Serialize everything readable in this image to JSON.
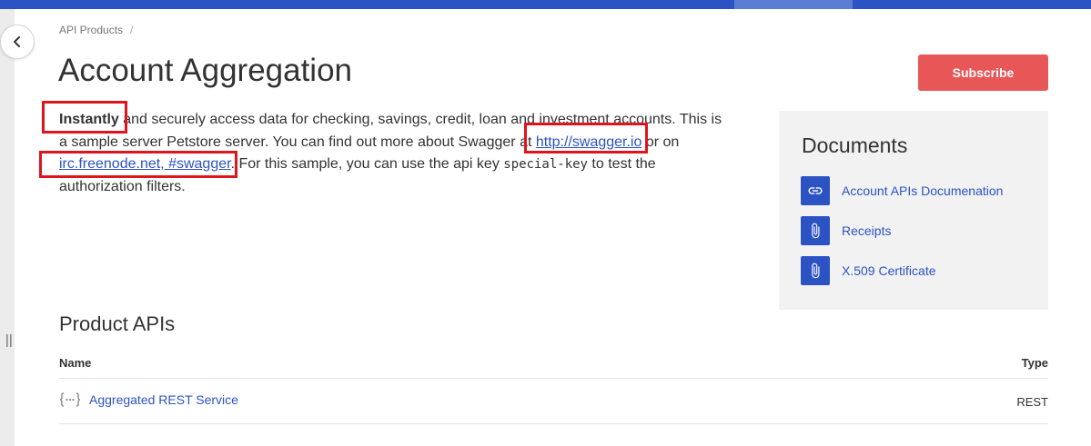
{
  "breadcrumb": {
    "item": "API Products",
    "separator": "/"
  },
  "page": {
    "title": "Account Aggregation",
    "subscribe_label": "Subscribe"
  },
  "description": {
    "bold": "Instantly",
    "text1": " and securely access data for checking, savings, credit, loan and investment accounts. This is a sample server Petstore server. You can find out more about Swagger at ",
    "link1": "http://swagger.io",
    "text2": " or on ",
    "link2": "irc.freenode.net, #swagger",
    "text3": ". For this sample, you can use the api key ",
    "code": "special-key",
    "text4": " to test the authorization filters."
  },
  "documents": {
    "title": "Documents",
    "items": [
      {
        "label": "Account APIs Documenation",
        "icon": "link-icon"
      },
      {
        "label": "Receipts",
        "icon": "paperclip-icon"
      },
      {
        "label": "X.509 Certificate",
        "icon": "paperclip-icon"
      }
    ]
  },
  "product_apis": {
    "title": "Product APIs",
    "columns": {
      "name": "Name",
      "type": "Type"
    },
    "rows": [
      {
        "name": "Aggregated REST Service",
        "type": "REST",
        "icon": "curly-braces-icon"
      }
    ]
  },
  "colors": {
    "accent": "#2c53c4",
    "subscribe": "#e85757",
    "highlight": "#e0141e",
    "panel": "#f2f2f2"
  }
}
